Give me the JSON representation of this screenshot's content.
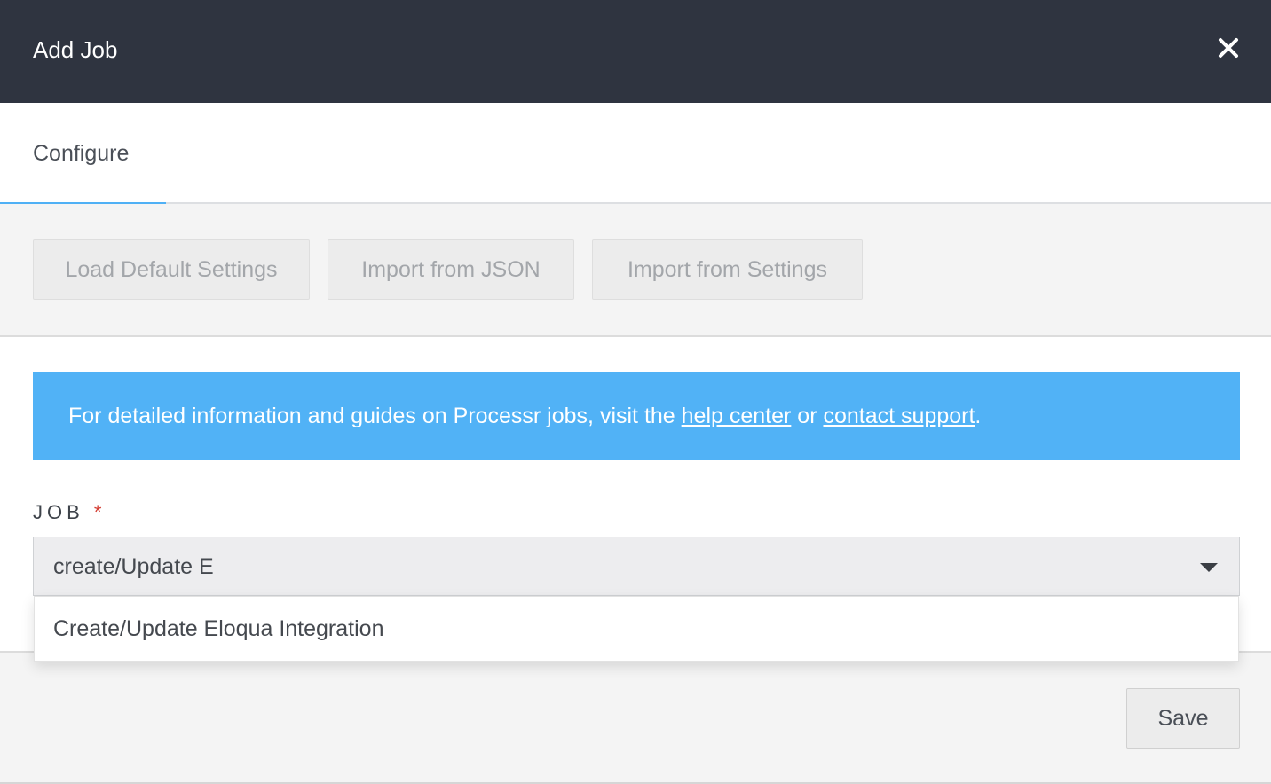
{
  "modal": {
    "title": "Add Job",
    "close_icon": "close-icon"
  },
  "tabs": [
    {
      "label": "Configure",
      "active": true
    }
  ],
  "toolbar": {
    "load_default_label": "Load Default Settings",
    "import_json_label": "Import from JSON",
    "import_settings_label": "Import from Settings"
  },
  "info": {
    "text_before": "For detailed information and guides on Processr jobs, visit the ",
    "help_link": "help center",
    "text_middle": " or ",
    "support_link": "contact support",
    "text_after": ".",
    "color": "#51b2f6"
  },
  "job_field": {
    "label": "JOB",
    "required_mark": "*",
    "value": "create/Update E",
    "caret_icon": "caret-down-icon"
  },
  "dropdown": {
    "options": [
      "Create/Update Eloqua Integration"
    ]
  },
  "footer": {
    "save_label": "Save"
  }
}
